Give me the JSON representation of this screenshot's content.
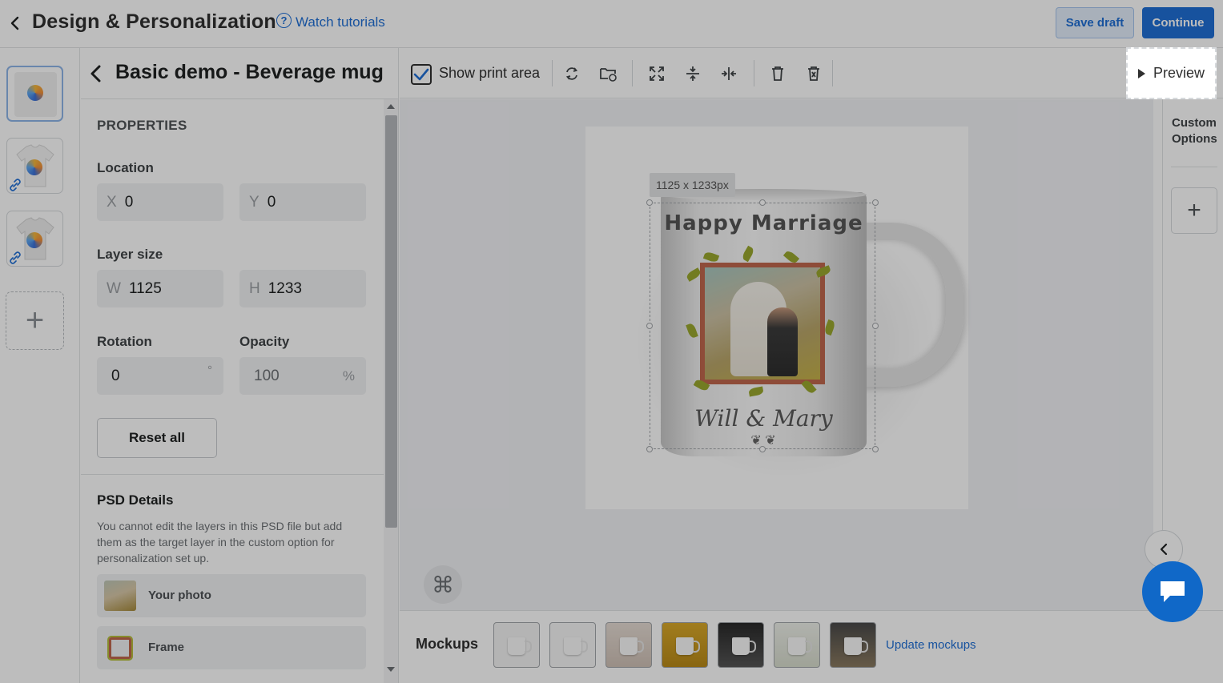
{
  "header": {
    "title": "Design & Personalization",
    "help_icon": "question-circle-icon",
    "watch_tutorials": "Watch tutorials",
    "save_draft": "Save draft",
    "continue": "Continue"
  },
  "panel": {
    "title": "Basic demo - Beverage mug",
    "section": "PROPERTIES",
    "location_label": "Location",
    "x_prefix": "X",
    "x_value": "0",
    "y_prefix": "Y",
    "y_value": "0",
    "layer_size_label": "Layer size",
    "w_prefix": "W",
    "w_value": "1125",
    "h_prefix": "H",
    "h_value": "1233",
    "rotation_label": "Rotation",
    "rotation_value": "0",
    "rotation_unit": "°",
    "opacity_label": "Opacity",
    "opacity_value": "100",
    "opacity_unit": "%",
    "reset_all": "Reset all",
    "psd_title": "PSD Details",
    "psd_desc": "You cannot edit the layers in this PSD file but add them as the target layer in the custom option for personalization set up.",
    "layers": [
      {
        "name": "Your photo"
      },
      {
        "name": "Frame"
      }
    ]
  },
  "toolbar": {
    "show_print_area": "Show print area",
    "show_print_area_checked": true,
    "preview": "Preview"
  },
  "canvas": {
    "size_tag": "1125 x 1233px",
    "mug_headline": "Happy Marriage",
    "mug_script": "Will & Mary",
    "mug_ornament": "❦ ❦"
  },
  "rightbar": {
    "custom_options": "Custom Options"
  },
  "mockups": {
    "label": "Mockups",
    "update": "Update mockups"
  },
  "colors": {
    "accent": "#1f6fd6",
    "chat": "#1068c8"
  }
}
